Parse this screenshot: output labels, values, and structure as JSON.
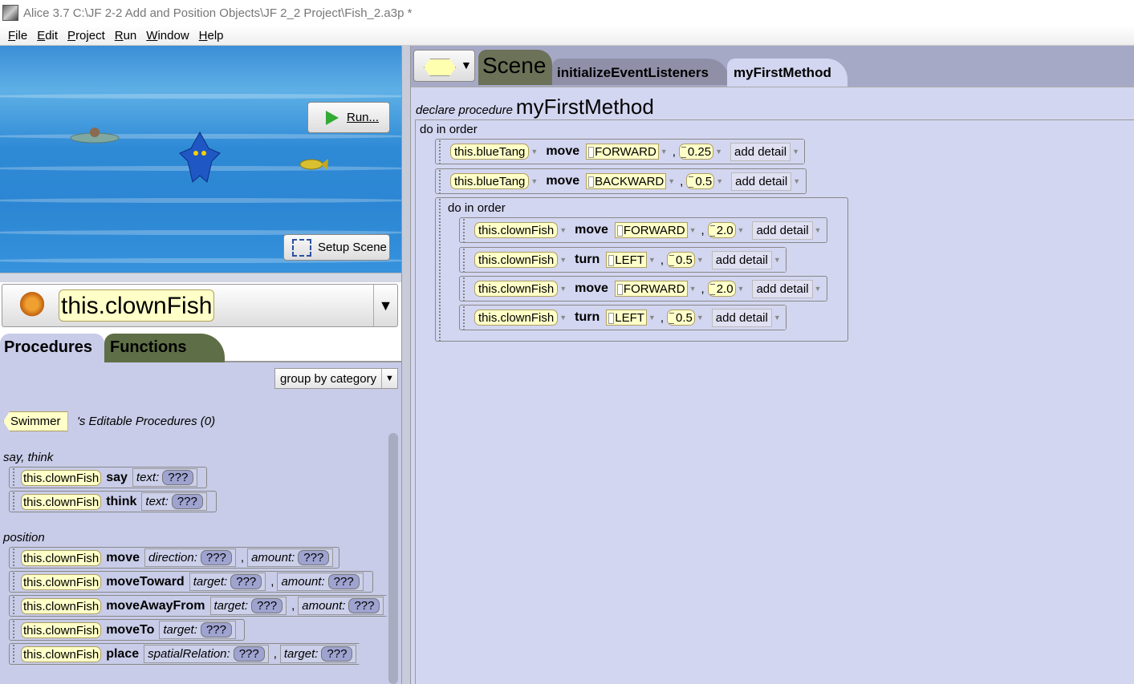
{
  "window": {
    "title": "Alice 3.7 C:\\JF 2-2 Add and Position Objects\\JF 2_2 Project\\Fish_2.a3p *"
  },
  "menu": [
    "File",
    "Edit",
    "Project",
    "Run",
    "Window",
    "Help"
  ],
  "scene": {
    "run_label": "Run...",
    "setup_label": "Setup Scene"
  },
  "object_selector": {
    "selected": "this.clownFish"
  },
  "left_tabs": {
    "procedures": "Procedures",
    "functions": "Functions"
  },
  "group_by": "group by category",
  "editable": {
    "type": "Swimmer",
    "label": "'s Editable Procedures (0)"
  },
  "categories": {
    "say_think": "say, think",
    "position": "position"
  },
  "templates": [
    {
      "obj": "this.clownFish",
      "method": "say",
      "params": [
        "text:"
      ],
      "q": [
        "???"
      ]
    },
    {
      "obj": "this.clownFish",
      "method": "think",
      "params": [
        "text:"
      ],
      "q": [
        "???"
      ]
    },
    {
      "obj": "this.clownFish",
      "method": "move",
      "params": [
        "direction:",
        "amount:"
      ],
      "q": [
        "???",
        "???"
      ]
    },
    {
      "obj": "this.clownFish",
      "method": "moveToward",
      "params": [
        "target:",
        "amount:"
      ],
      "q": [
        "???",
        "???"
      ]
    },
    {
      "obj": "this.clownFish",
      "method": "moveAwayFrom",
      "params": [
        "target:",
        "amount:"
      ],
      "q": [
        "???",
        "???"
      ]
    },
    {
      "obj": "this.clownFish",
      "method": "moveTo",
      "params": [
        "target:"
      ],
      "q": [
        "???"
      ]
    },
    {
      "obj": "this.clownFish",
      "method": "place",
      "params": [
        "spatialRelation:",
        "target:"
      ],
      "q": [
        "???",
        "???"
      ]
    }
  ],
  "editor_tabs": {
    "scene": "Scene",
    "init": "initializeEventListeners",
    "first": "myFirstMethod"
  },
  "declaration": {
    "keyword": "declare procedure",
    "name": "myFirstMethod"
  },
  "do_in_order": "do in order",
  "add_detail": "add detail",
  "statements": [
    {
      "obj": "this.blueTang",
      "method": "move",
      "dir": "FORWARD",
      "amount": "0.25"
    },
    {
      "obj": "this.blueTang",
      "method": "move",
      "dir": "BACKWARD",
      "amount": "0.5"
    }
  ],
  "nested_statements": [
    {
      "obj": "this.clownFish",
      "method": "move",
      "dir": "FORWARD",
      "amount": "2.0"
    },
    {
      "obj": "this.clownFish",
      "method": "turn",
      "dir": "LEFT",
      "amount": "0.5"
    },
    {
      "obj": "this.clownFish",
      "method": "move",
      "dir": "FORWARD",
      "amount": "2.0"
    },
    {
      "obj": "this.clownFish",
      "method": "turn",
      "dir": "LEFT",
      "amount": "0.5"
    }
  ]
}
